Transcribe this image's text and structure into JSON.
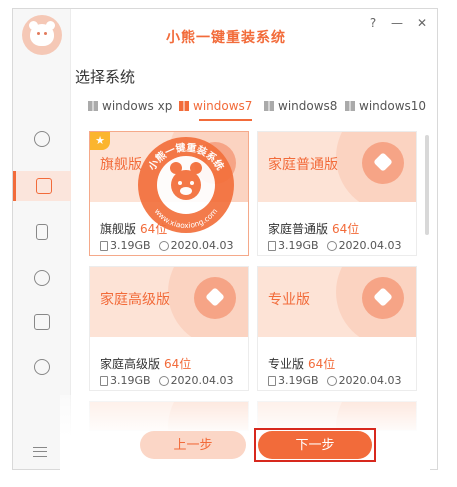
{
  "app": {
    "title": "小熊一键重装系统"
  },
  "window_controls": {
    "help": "?",
    "minimize": "—",
    "close": "✕"
  },
  "sidebar": {
    "items": [
      {
        "icon": "bear-icon",
        "active": false
      },
      {
        "icon": "monitor-icon",
        "active": true
      },
      {
        "icon": "usb-icon",
        "active": false
      },
      {
        "icon": "chat-icon",
        "active": false
      },
      {
        "icon": "help-book-icon",
        "active": false
      },
      {
        "icon": "planet-icon",
        "active": false
      }
    ],
    "menu_icon": "menu-icon"
  },
  "section_title": "选择系统",
  "tabs": [
    {
      "label": "windows xp",
      "active": false
    },
    {
      "label": "windows7",
      "active": true
    },
    {
      "label": "windows8",
      "active": false
    },
    {
      "label": "windows10",
      "active": false
    }
  ],
  "cards": [
    {
      "label": "旗舰版",
      "name": "旗舰版",
      "bits": "64位",
      "size": "3.19GB",
      "date": "2020.04.03",
      "selected": true,
      "badge": "★"
    },
    {
      "label": "家庭普通版",
      "name": "家庭普通版",
      "bits": "64位",
      "size": "3.19GB",
      "date": "2020.04.03",
      "selected": false
    },
    {
      "label": "家庭高级版",
      "name": "家庭高级版",
      "bits": "64位",
      "size": "3.19GB",
      "date": "2020.04.03",
      "selected": false
    },
    {
      "label": "专业版",
      "name": "专业版",
      "bits": "64位",
      "size": "3.19GB",
      "date": "2020.04.03",
      "selected": false
    }
  ],
  "watermark": {
    "top_text": "小熊一键重装系统",
    "bottom_text": "www.xiaoxiong.com"
  },
  "buttons": {
    "prev": "上一步",
    "next": "下一步"
  },
  "colors": {
    "accent": "#f26b3a",
    "highlight": "#d7281d"
  }
}
